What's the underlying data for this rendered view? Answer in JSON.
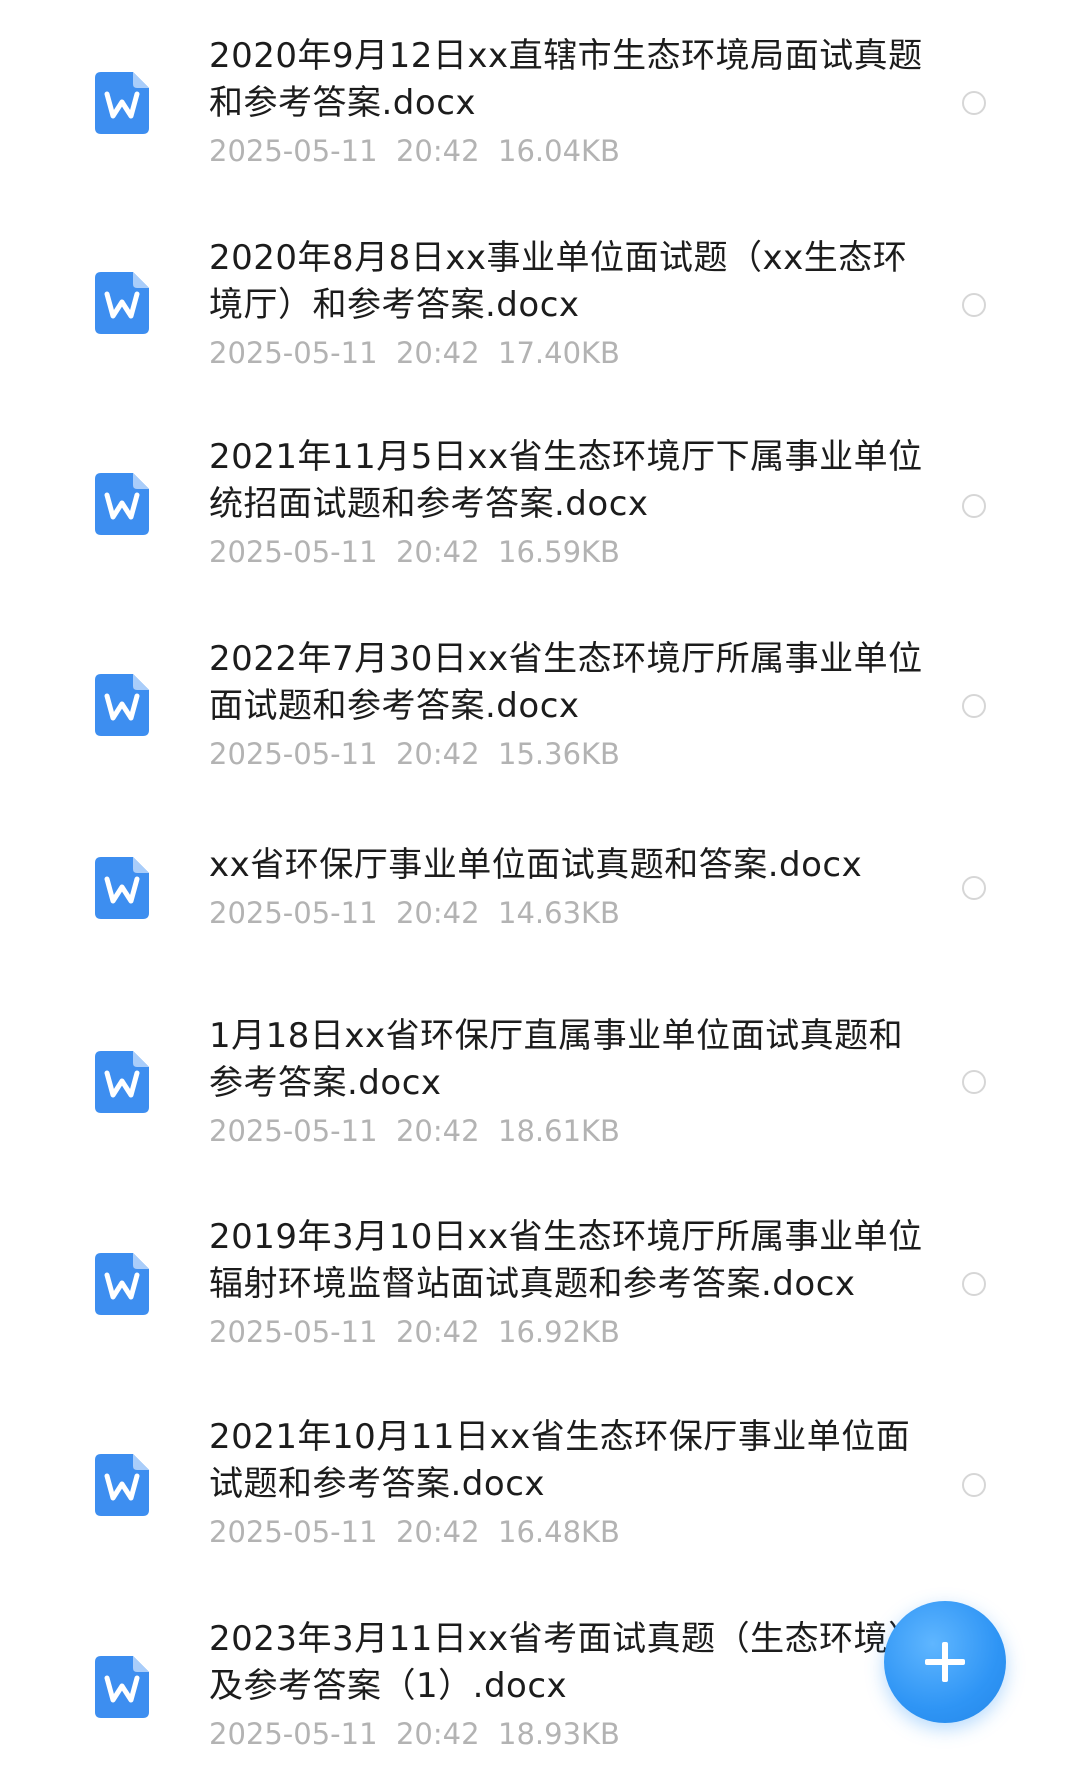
{
  "files": [
    {
      "name": "2020年9月12日xx直辖市生态环境局面试真题和参考答案.docx",
      "date": "2025-05-11",
      "time": "20:42",
      "size": "16.04KB",
      "icon": "word-doc-icon"
    },
    {
      "name": "2020年8月8日xx事业单位面试题（xx生态环境厅）和参考答案.docx",
      "date": "2025-05-11",
      "time": "20:42",
      "size": "17.40KB",
      "icon": "word-doc-icon"
    },
    {
      "name": "2021年11月5日xx省生态环境厅下属事业单位统招面试题和参考答案.docx",
      "date": "2025-05-11",
      "time": "20:42",
      "size": "16.59KB",
      "icon": "word-doc-icon"
    },
    {
      "name": "2022年7月30日xx省生态环境厅所属事业单位面试题和参考答案.docx",
      "date": "2025-05-11",
      "time": "20:42",
      "size": "15.36KB",
      "icon": "word-doc-icon"
    },
    {
      "name": "xx省环保厅事业单位面试真题和答案.docx",
      "date": "2025-05-11",
      "time": "20:42",
      "size": "14.63KB",
      "icon": "word-doc-icon"
    },
    {
      "name": "1月18日xx省环保厅直属事业单位面试真题和参考答案.docx",
      "date": "2025-05-11",
      "time": "20:42",
      "size": "18.61KB",
      "icon": "word-doc-icon"
    },
    {
      "name": "2019年3月10日xx省生态环境厅所属事业单位辐射环境监督站面试真题和参考答案.docx",
      "date": "2025-05-11",
      "time": "20:42",
      "size": "16.92KB",
      "icon": "word-doc-icon"
    },
    {
      "name": "2021年10月11日xx省生态环保厅事业单位面试题和参考答案.docx",
      "date": "2025-05-11",
      "time": "20:42",
      "size": "16.48KB",
      "icon": "word-doc-icon"
    },
    {
      "name": "2023年3月11日xx省考面试真题（生态环境）及参考答案（1）.docx",
      "date": "2025-05-11",
      "time": "20:42",
      "size": "18.93KB",
      "icon": "word-doc-icon"
    }
  ],
  "fab": {
    "icon": "plus-icon"
  },
  "colors": {
    "accent": "#2f95f5",
    "icon_blue": "#3d8ef0",
    "meta_text": "#b3b3b3"
  }
}
